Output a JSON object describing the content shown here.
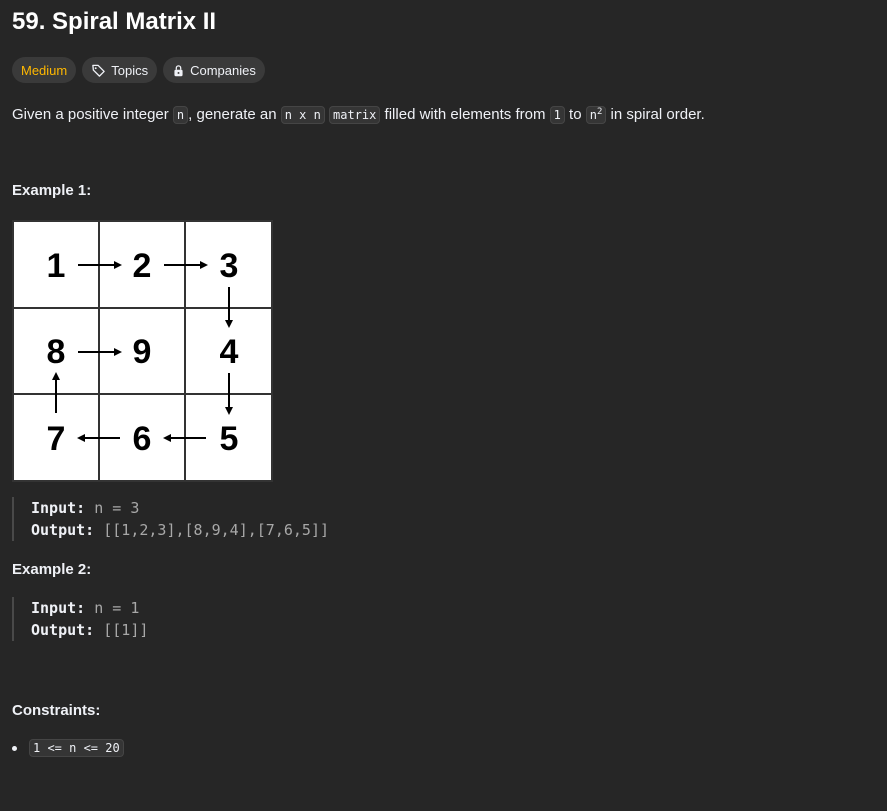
{
  "problem": {
    "title": "59. Spiral Matrix II",
    "difficulty": "Medium",
    "tags": [
      "Topics",
      "Companies"
    ],
    "icons": {
      "topics": "tag-icon",
      "companies": "lock-icon"
    },
    "colors": {
      "medium": "#ffb800",
      "background": "#262626"
    }
  },
  "description": {
    "t1": "Given a positive integer ",
    "c1": "n",
    "t2": ", generate an ",
    "c2": "n x n",
    "t3": " ",
    "c3": "matrix",
    "t4": " filled with elements from ",
    "c4": "1",
    "t5": " to ",
    "c5": "n",
    "c5sup": "2",
    "t6": " in spiral order."
  },
  "example1": {
    "heading": "Example 1:",
    "grid": [
      [
        "1",
        "2",
        "3"
      ],
      [
        "8",
        "9",
        "4"
      ],
      [
        "7",
        "6",
        "5"
      ]
    ],
    "input_label": "Input:",
    "input_value": "n = 3",
    "output_label": "Output:",
    "output_value": "[[1,2,3],[8,9,4],[7,6,5]]"
  },
  "example2": {
    "heading": "Example 2:",
    "input_label": "Input:",
    "input_value": "n = 1",
    "output_label": "Output:",
    "output_value": "[[1]]"
  },
  "constraints": {
    "heading": "Constraints:",
    "items": [
      "1 <= n <= 20"
    ]
  }
}
